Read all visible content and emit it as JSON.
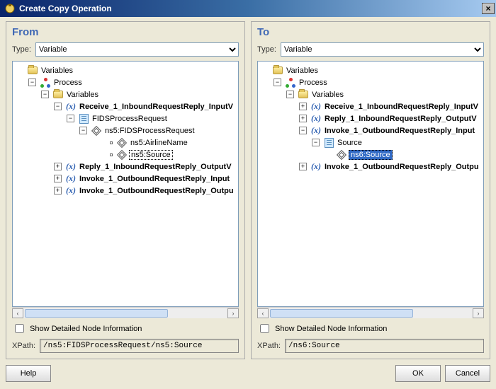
{
  "title": "Create Copy Operation",
  "from": {
    "heading": "From",
    "typeLabel": "Type:",
    "typeValue": "Variable",
    "checkboxLabel": "Show Detailed Node Information",
    "xpathLabel": "XPath:",
    "xpathValue": "/ns5:FIDSProcessRequest/ns5:Source",
    "tree": {
      "root": "Variables",
      "process": "Process",
      "vars": "Variables",
      "v0": "Receive_1_InboundRequestReply_InputV",
      "v0doc": "FIDSProcessRequest",
      "v0d0": "ns5:FIDSProcessRequest",
      "v0d0a": "ns5:AirlineName",
      "v0d0b": "ns5:Source",
      "v1": "Reply_1_InboundRequestReply_OutputV",
      "v2": "Invoke_1_OutboundRequestReply_Input",
      "v3": "Invoke_1_OutboundRequestReply_Outpu"
    }
  },
  "to": {
    "heading": "To",
    "typeLabel": "Type:",
    "typeValue": "Variable",
    "checkboxLabel": "Show Detailed Node Information",
    "xpathLabel": "XPath:",
    "xpathValue": "/ns6:Source",
    "tree": {
      "root": "Variables",
      "process": "Process",
      "vars": "Variables",
      "v0": "Receive_1_InboundRequestReply_InputV",
      "v1": "Reply_1_InboundRequestReply_OutputV",
      "v2": "Invoke_1_OutboundRequestReply_Input",
      "v2src": "Source",
      "v2srcItem": "ns6:Source",
      "v3": "Invoke_1_OutboundRequestReply_Outpu"
    }
  },
  "buttons": {
    "help": "Help",
    "ok": "OK",
    "cancel": "Cancel"
  }
}
